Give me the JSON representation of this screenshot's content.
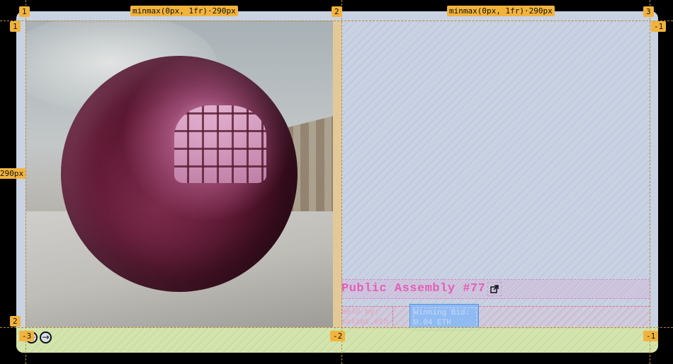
{
  "grid_overlay": {
    "column_track_label": "minmax(0px, 1fr)·290px",
    "row_track_label": "290px",
    "column_lines_top": [
      "1",
      "2",
      "3"
    ],
    "row_lines_left": [
      "1",
      "2"
    ],
    "row_lines_right": [
      "-1",
      "-1"
    ],
    "column_lines_bottom": [
      "-3",
      "-2",
      "-1"
    ]
  },
  "artwork": {
    "image_alt": "chrome pink sphere reflecting a building interior"
  },
  "listing": {
    "title": "Public Assembly #77",
    "held_by_label": "Held by:",
    "held_by_value": "saliet.eth",
    "bid_label": "Winning Bid:",
    "bid_value": "0.04 ETH"
  },
  "navigation": {
    "prev_icon": "arrow-left-circle-icon",
    "next_icon": "arrow-right-circle-icon"
  },
  "colors": {
    "title": "#e35fb8",
    "grid_marker": "#f2b33d",
    "card_bg": "#c8d2e2",
    "bid_box": "#8fbaf2"
  }
}
